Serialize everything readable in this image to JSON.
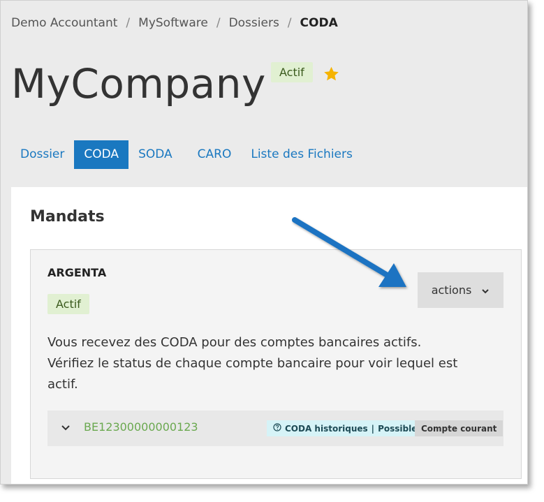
{
  "breadcrumb": {
    "items": [
      "Demo Accountant",
      "MySoftware",
      "Dossiers"
    ],
    "current": "CODA",
    "separator": "/"
  },
  "page": {
    "title": "MyCompany",
    "status_badge": "Actif",
    "star_icon": "star-icon"
  },
  "tabs": [
    {
      "label": "Dossier",
      "active": false
    },
    {
      "label": "CODA",
      "active": true
    },
    {
      "label": "SODA",
      "active": false
    },
    {
      "label": "CARO",
      "active": false
    },
    {
      "label": "Liste des Fichiers",
      "active": false
    }
  ],
  "mandats": {
    "heading": "Mandats",
    "card": {
      "bank": "ARGENTA",
      "status_badge": "Actif",
      "actions_label": "actions",
      "description": "Vous recevez des CODA pour des comptes bancaires actifs. Vérifiez le status de chaque compte bancaire pour voir lequel est actif.",
      "account": {
        "number": "BE12300000000123",
        "coda_history_label": "CODA historiques",
        "coda_history_status": "Possible",
        "account_type": "Compte courant"
      }
    }
  },
  "colors": {
    "accent": "#1a78c0",
    "active_badge_bg": "#e1f0d2",
    "star": "#f5b301",
    "annotation_arrow": "#1a73c2"
  }
}
